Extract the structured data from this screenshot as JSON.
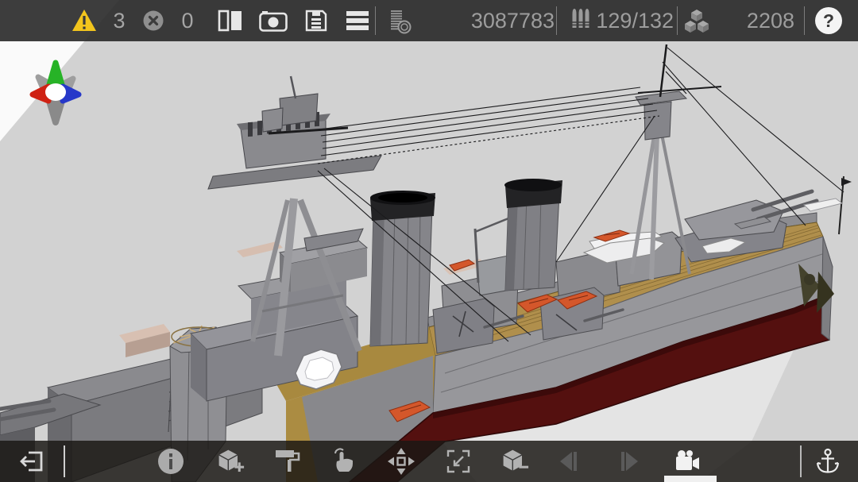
{
  "topbar": {
    "warnings": {
      "icon": "warning-icon",
      "count": "3"
    },
    "errors": {
      "icon": "error-circle-icon",
      "count": "0"
    },
    "tools": [
      {
        "icon": "panels-icon"
      },
      {
        "icon": "camera-snapshot-icon"
      },
      {
        "icon": "save-icon"
      },
      {
        "icon": "menu-icon"
      }
    ],
    "stats": [
      {
        "icon": "coins-stack-icon",
        "value": "3087783"
      },
      {
        "icon": "shells-icon",
        "value": "129/132"
      },
      {
        "icon": "cubes-icon",
        "value": "2208"
      }
    ],
    "help": {
      "icon": "help-circle-icon",
      "glyph": "?"
    }
  },
  "viewport": {
    "content": "low-poly battleship 3d model, front-left elevated view",
    "gizmo_axes": {
      "up": "green",
      "left": "red",
      "right": "blue",
      "others": "gray"
    },
    "colors": {
      "background": "#d2d2d2",
      "corner_wedge": "#fafafa",
      "hull_gray": "#97979b",
      "hull_red": "#54100f",
      "deck_tan": "#b08f4c",
      "funnel_cap": "#1c1c1e",
      "boat_orange": "#d4572b",
      "boat_white": "#efefef",
      "accent_pink": "#d9c2b4"
    }
  },
  "bottombar": {
    "items": [
      {
        "icon": "exit-icon"
      },
      {
        "icon": "info-icon"
      },
      {
        "icon": "add-block-icon"
      },
      {
        "icon": "paint-roller-icon"
      },
      {
        "icon": "tap-hand-icon"
      },
      {
        "icon": "move-icon"
      },
      {
        "icon": "scale-icon"
      },
      {
        "icon": "remove-block-icon"
      },
      {
        "icon": "prev-icon",
        "disabled": true
      },
      {
        "icon": "next-icon",
        "disabled": true
      },
      {
        "icon": "camera-mode-icon",
        "active": true
      },
      {
        "icon": "anchor-icon"
      }
    ]
  }
}
